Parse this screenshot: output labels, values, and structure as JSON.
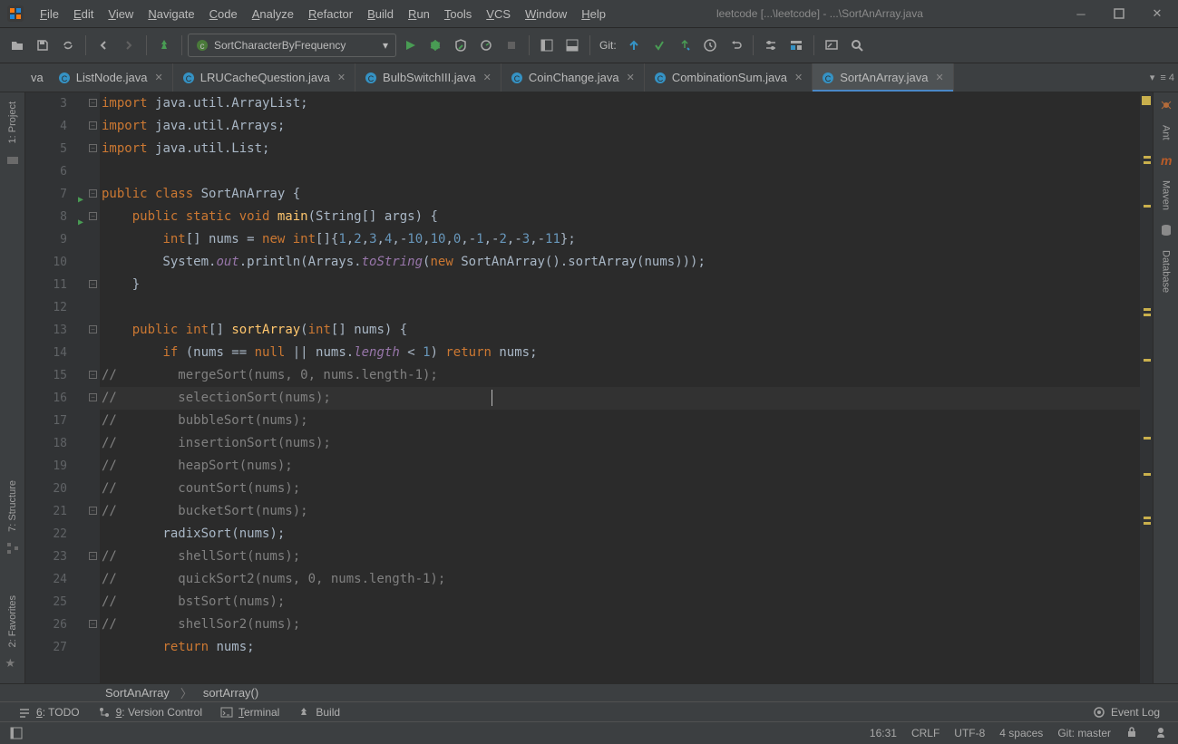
{
  "title": "leetcode [...\\leetcode] - ...\\SortAnArray.java",
  "menus": [
    "File",
    "Edit",
    "View",
    "Navigate",
    "Code",
    "Analyze",
    "Refactor",
    "Build",
    "Run",
    "Tools",
    "VCS",
    "Window",
    "Help"
  ],
  "run_config": "SortCharacterByFrequency",
  "git_label": "Git:",
  "tabs": [
    {
      "name": "ListNode.java",
      "active": false
    },
    {
      "name": "LRUCacheQuestion.java",
      "active": false
    },
    {
      "name": "BulbSwitchIII.java",
      "active": false
    },
    {
      "name": "CoinChange.java",
      "active": false
    },
    {
      "name": "CombinationSum.java",
      "active": false
    },
    {
      "name": "SortAnArray.java",
      "active": true
    }
  ],
  "tab_extra": "≡ 4",
  "left_tools": [
    {
      "label": "1: Project"
    },
    {
      "label": "7: Structure"
    },
    {
      "label": "2: Favorites"
    }
  ],
  "right_tools": [
    "Ant",
    "Maven",
    "Database"
  ],
  "code_lines": [
    {
      "n": 3,
      "html": "<span class='kw'>import </span>java.util.ArrayList;"
    },
    {
      "n": 4,
      "html": "<span class='kw'>import </span>java.util.Arrays;"
    },
    {
      "n": 5,
      "html": "<span class='kw'>import </span>java.util.List;"
    },
    {
      "n": 6,
      "html": ""
    },
    {
      "n": 7,
      "html": "<span class='kw'>public class </span>SortAnArray {",
      "run": true
    },
    {
      "n": 8,
      "html": "    <span class='kw'>public static void </span><span class='mth'>main</span>(String[] args) {",
      "run": true
    },
    {
      "n": 9,
      "html": "        <span class='kw'>int</span>[] nums = <span class='kw'>new int</span>[]{<span class='num'>1</span>,<span class='num'>2</span>,<span class='num'>3</span>,<span class='num'>4</span>,-<span class='num'>10</span>,<span class='num'>10</span>,<span class='num'>0</span>,-<span class='num'>1</span>,-<span class='num'>2</span>,-<span class='num'>3</span>,-<span class='num'>11</span>};"
    },
    {
      "n": 10,
      "html": "        System.<span class='fld'>out</span>.println(Arrays.<span class='fld'>toString</span>(<span class='kw'>new </span>SortAnArray().sortArray(nums)));"
    },
    {
      "n": 11,
      "html": "    }"
    },
    {
      "n": 12,
      "html": ""
    },
    {
      "n": 13,
      "html": "    <span class='kw'>public int</span>[] <span class='mth'>sortArray</span>(<span class='kw'>int</span>[] nums) {"
    },
    {
      "n": 14,
      "html": "        <span class='kw'>if </span>(nums == <span class='kw'>null </span>|| nums.<span class='fld'>length</span> &lt; <span class='num'>1</span>) <span class='kw'>return </span>nums;"
    },
    {
      "n": 15,
      "html": "<span class='cmt'>//        mergeSort(nums, 0, nums.length-1);</span>"
    },
    {
      "n": 16,
      "html": "<span class='cmt'>//        selectionSort(nums);</span>                     <span class='cursor'></span>",
      "hl": true
    },
    {
      "n": 17,
      "html": "<span class='cmt'>//        bubbleSort(nums);</span>"
    },
    {
      "n": 18,
      "html": "<span class='cmt'>//        insertionSort(nums);</span>"
    },
    {
      "n": 19,
      "html": "<span class='cmt'>//        heapSort(nums);</span>"
    },
    {
      "n": 20,
      "html": "<span class='cmt'>//        countSort(nums);</span>"
    },
    {
      "n": 21,
      "html": "<span class='cmt'>//        bucketSort(nums);</span>"
    },
    {
      "n": 22,
      "html": "        radixSort(nums);"
    },
    {
      "n": 23,
      "html": "<span class='cmt'>//        shellSort(nums);</span>"
    },
    {
      "n": 24,
      "html": "<span class='cmt'>//        quickSort2(nums, 0, nums.length-1);</span>"
    },
    {
      "n": 25,
      "html": "<span class='cmt'>//        bstSort(nums);</span>"
    },
    {
      "n": 26,
      "html": "<span class='cmt'>//        shellSor2(nums);</span>"
    },
    {
      "n": 27,
      "html": "        <span class='kw'>return </span>nums;"
    }
  ],
  "breadcrumb": [
    "SortAnArray",
    "sortArray()"
  ],
  "bottom_tools": [
    {
      "label": "6: TODO",
      "u": "6"
    },
    {
      "label": "9: Version Control",
      "u": "9"
    },
    {
      "label": "Terminal",
      "u": "T"
    },
    {
      "label": "Build"
    }
  ],
  "event_log": "Event Log",
  "status": {
    "pos": "16:31",
    "le": "CRLF",
    "enc": "UTF-8",
    "indent": "4 spaces",
    "git": "Git: master"
  }
}
